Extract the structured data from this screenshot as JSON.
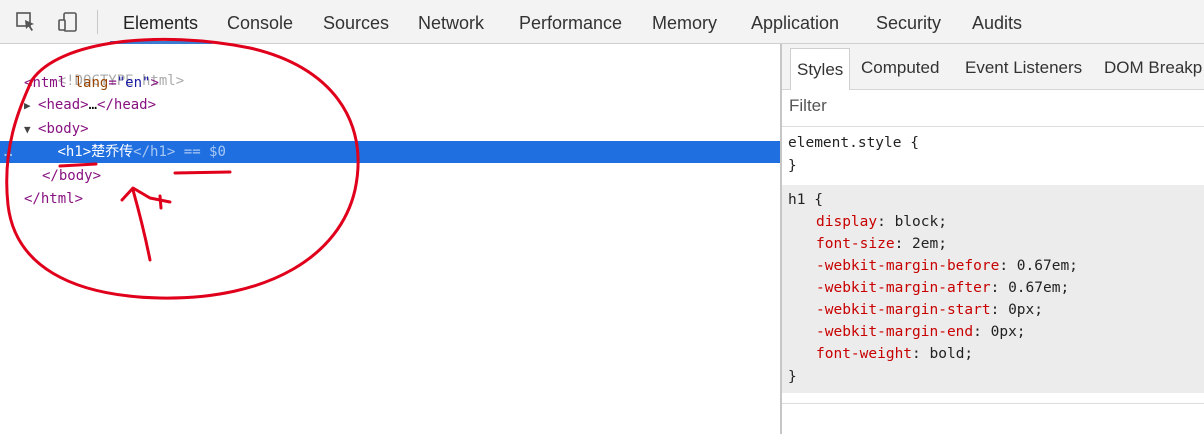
{
  "toolbar": {
    "tabs": [
      "Elements",
      "Console",
      "Sources",
      "Network",
      "Performance",
      "Memory",
      "Application",
      "Security",
      "Audits"
    ],
    "active_tab": "Elements",
    "icons": [
      "inspect-cursor-icon",
      "device-toggle-icon"
    ],
    "accent_color": "#3b7bd1"
  },
  "dom": {
    "doctype": "<!DOCTYPE html>",
    "html_open_tag": "html",
    "html_attr_name": "lang",
    "html_attr_value": "\"en\"",
    "head_tag": "head",
    "head_ellipsis": "…",
    "body_tag": "body",
    "h1_tag": "h1",
    "h1_text": "楚乔传",
    "selected_suffix": "== $0",
    "row_dots": "…",
    "body_close": "</body>",
    "html_close": "</html>",
    "selection_color": "#1f6fe0"
  },
  "sidebar": {
    "tabs": [
      "Styles",
      "Computed",
      "Event Listeners",
      "DOM Breakp"
    ],
    "active_tab": "Styles",
    "filter_placeholder": "Filter",
    "element_style_selector": "element.style {",
    "close_brace": "}",
    "h1_selector": "h1 {",
    "declarations": [
      {
        "prop": "display",
        "value": "block;"
      },
      {
        "prop": "font-size",
        "value": "2em;"
      },
      {
        "prop": "-webkit-margin-before",
        "value": "0.67em;"
      },
      {
        "prop": "-webkit-margin-after",
        "value": "0.67em;"
      },
      {
        "prop": "-webkit-margin-start",
        "value": "0px;"
      },
      {
        "prop": "-webkit-margin-end",
        "value": "0px;"
      },
      {
        "prop": "font-weight",
        "value": "bold;"
      }
    ]
  },
  "annotation": {
    "color": "#e0001b"
  }
}
